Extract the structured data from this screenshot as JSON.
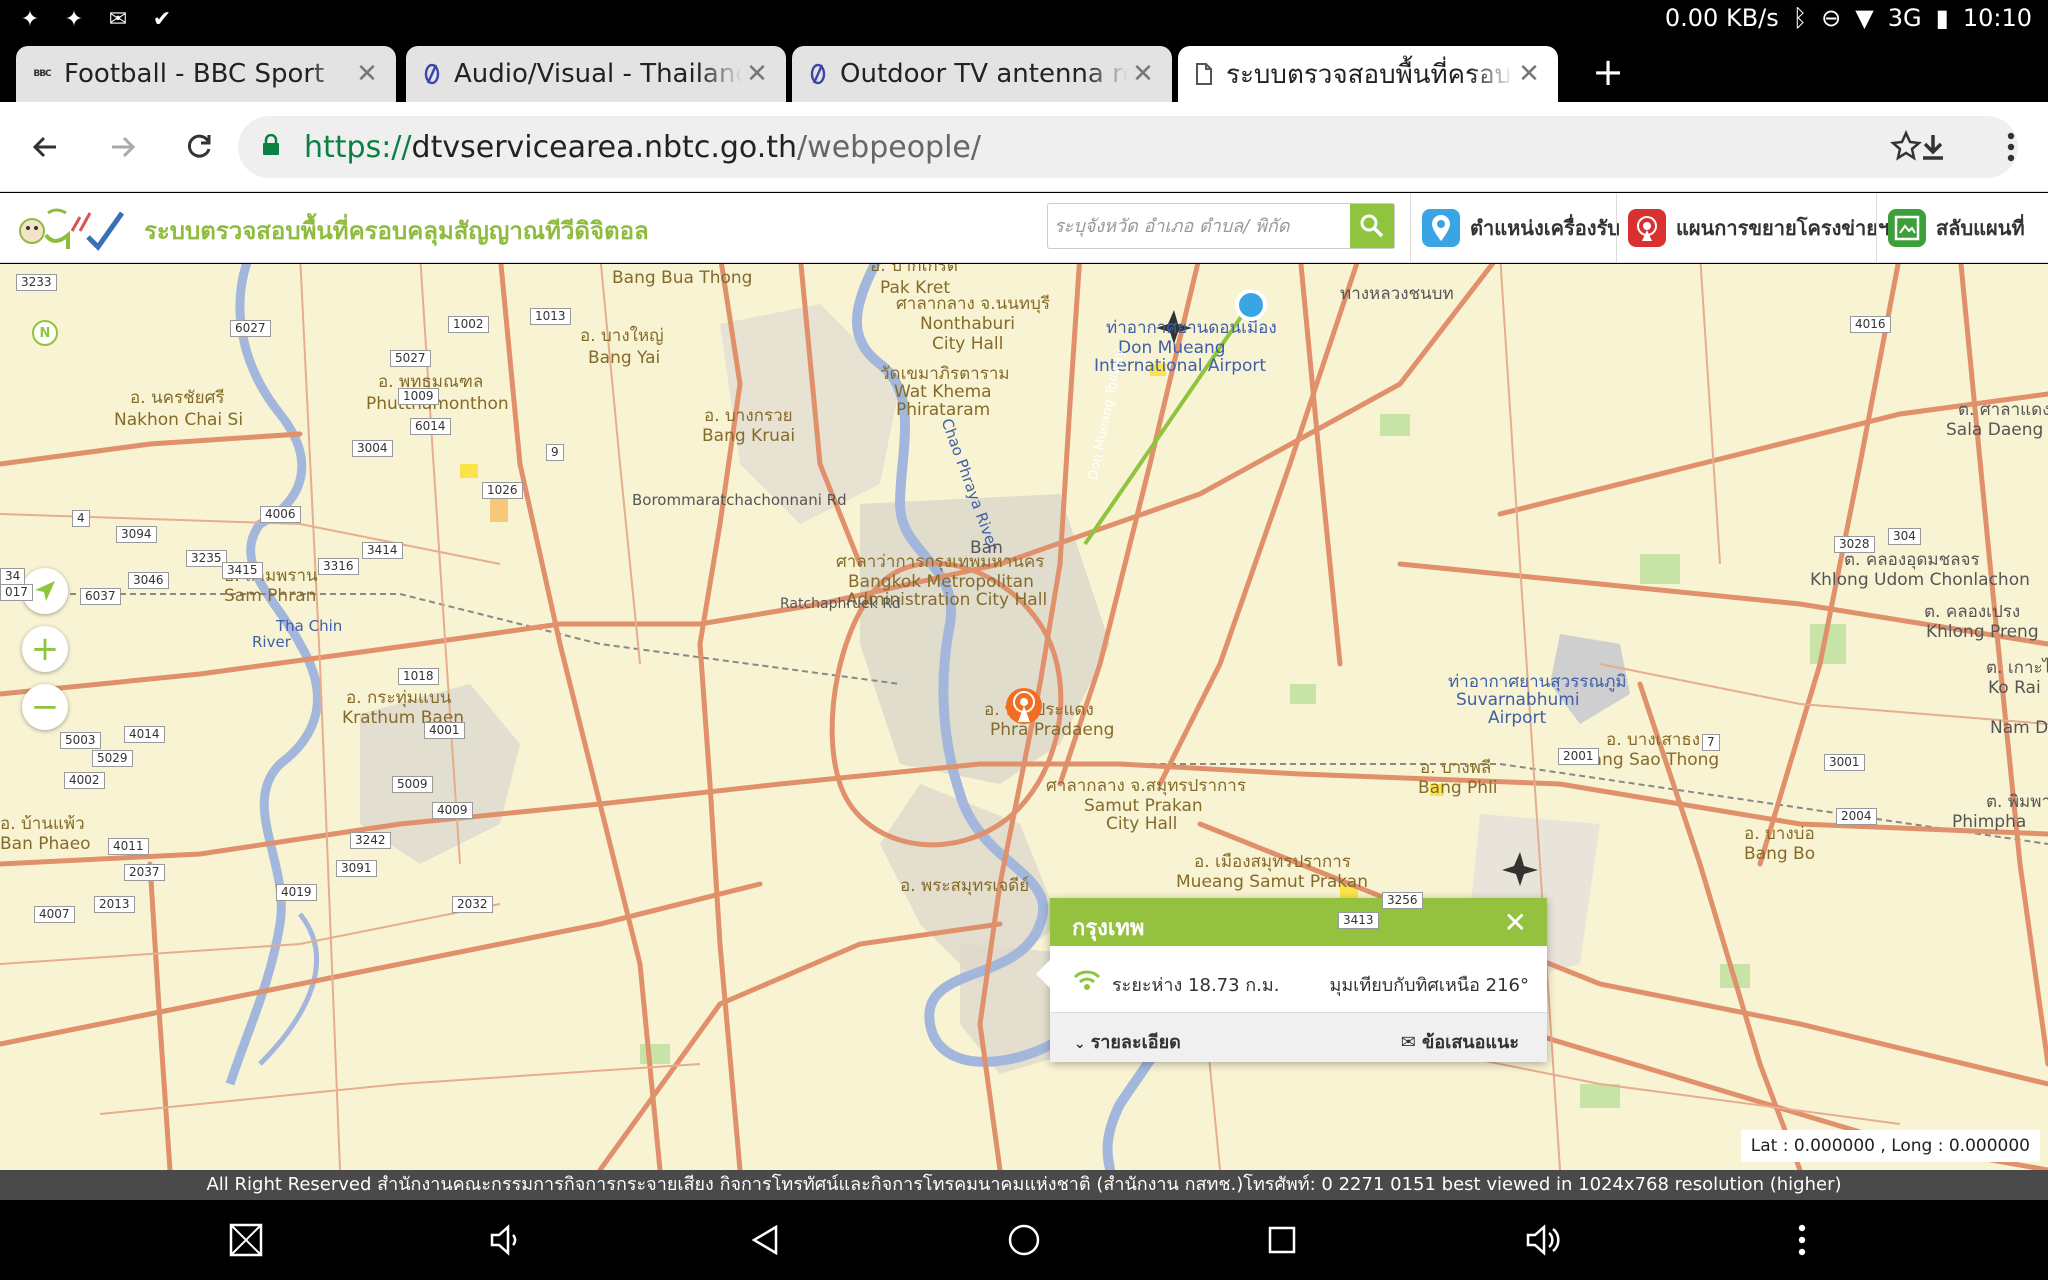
{
  "status": {
    "speed": "0.00 KB/s",
    "network": "3G",
    "time": "10:10"
  },
  "tabs": [
    {
      "favicon": "BBC",
      "title": "Football - BBC Sport"
    },
    {
      "favicon": "avs",
      "title": "Audio/Visual - Thailand Visa Forum"
    },
    {
      "favicon": "avs",
      "title": "Outdoor TV antenna reminder"
    },
    {
      "favicon": "doc",
      "title": "ระบบตรวจสอบพื้นที่ครอบคลุม"
    }
  ],
  "address": {
    "scheme": "https://",
    "host": "dtvservicearea.nbtc.go.th",
    "path": "/webpeople/"
  },
  "site": {
    "title": "ระบบตรวจสอบพื้นที่ครอบคลุมสัญญาณทีวีดิจิตอล",
    "search_placeholder": "ระบุจังหวัด อำเภอ ตำบล/ พิกัด",
    "buttons": [
      "ตำแหน่งเครื่องรับ",
      "แผนการขยายโครงข่ายฯ",
      "สลับแผนที่"
    ]
  },
  "map": {
    "labels": [
      "Bang Bua Thong",
      "อ. ปากเกร็ด",
      "Pak Kret",
      "ท่าอากาศยานดอนเมือง",
      "Don Mueang",
      "International Airport",
      "ศาลากลาง จ.นนทบุรี",
      "Nonthaburi",
      "City Hall",
      "อ. บางใหญ่",
      "Bang Yai",
      "อ. พุทธมณฑล",
      "Phutthamonthon",
      "อ. นครชัยศรี",
      "Nakhon Chai Si",
      "วัดเขมาภิรตาราม",
      "Wat Khema",
      "Phirataram",
      "อ. บางกรวย",
      "Bang Kruai",
      "Borommaratchachonnani Rd",
      "อ. สามพราน",
      "Sam Phran",
      "Tha Chin",
      "River",
      "ศาลาว่าการกรุงเทพมหานคร",
      "Bangkok Metropolitan",
      "Administration City Hall",
      "Ratchaphruek Rd",
      "อ. กระทุ่มแบน",
      "Krathum Baen",
      "อ. พระประแดง",
      "Phra Pradaeng",
      "ศาลากลาง จ.สมุทรปราการ",
      "Samut Prakan",
      "City Hall",
      "อ. เมืองสมุทรปราการ",
      "Mueang Samut Prakan",
      "อ. พระสมุทรเจดีย์",
      "อ. บ้านแพ้ว",
      "Ban Phaeo",
      "ท่าอากาศยานสุวรรณภูมิ",
      "Suvarnabhumi",
      "Airport",
      "อ. บางพลี",
      "Bang Phli",
      "อ. บางเสาธง",
      "Bang Sao Thong",
      "อ. บางบ่อ",
      "Bang Bo",
      "Khlong Udom Chonlachon",
      "Khlong Preng",
      "Sala Daeng",
      "Ko Rai",
      "Phimpha",
      "Don Mueang Tollway",
      "Chao Phraya River",
      "Ban",
      "ต. คลองอุดมชลจร",
      "ต. คลองเปรง",
      "ต. ศาลาแดง",
      "ต. เกาะไร่",
      "ต. พิมพา",
      "Nam Daeng",
      "ทางหลวงชนบท"
    ],
    "road_numbers": [
      "3233",
      "6027",
      "1002",
      "1013",
      "5027",
      "1009",
      "3004",
      "6014",
      "1026",
      "9",
      "4006",
      "4",
      "3094",
      "3235",
      "3414",
      "3415",
      "3316",
      "3046",
      "6037",
      "1018",
      "4001",
      "4014",
      "5029",
      "4002",
      "5009",
      "4009",
      "4011",
      "3242",
      "2037",
      "3091",
      "4019",
      "2013",
      "2032",
      "4007",
      "5003",
      "3256",
      "3413",
      "7",
      "2001",
      "3001",
      "2004",
      "3028",
      "304",
      "4016",
      "017",
      "34"
    ],
    "compass": "N"
  },
  "popup": {
    "title": "กรุงเทพ",
    "distance": "ระยะห่าง 18.73 ก.ม.",
    "angle": "มุมเทียบกับทิศเหนือ 216°",
    "details": "รายละเอียด",
    "suggestion": "ข้อเสนอแนะ"
  },
  "latlong": "Lat : 0.000000 , Long : 0.000000",
  "footer": "All Right Reserved สำนักงานคณะกรรมการกิจการกระจายเสียง กิจการโทรทัศน์และกิจการโทรคมนาคมแห่งชาติ (สำนักงาน กสทช.)โทรศัพท์: 0 2271 0151 best viewed in 1024x768 resolution (higher)",
  "colors": {
    "accent": "#94c23f",
    "map_bg": "#f8f3d2",
    "road": "#e0906a",
    "river": "#a3b7dd"
  }
}
